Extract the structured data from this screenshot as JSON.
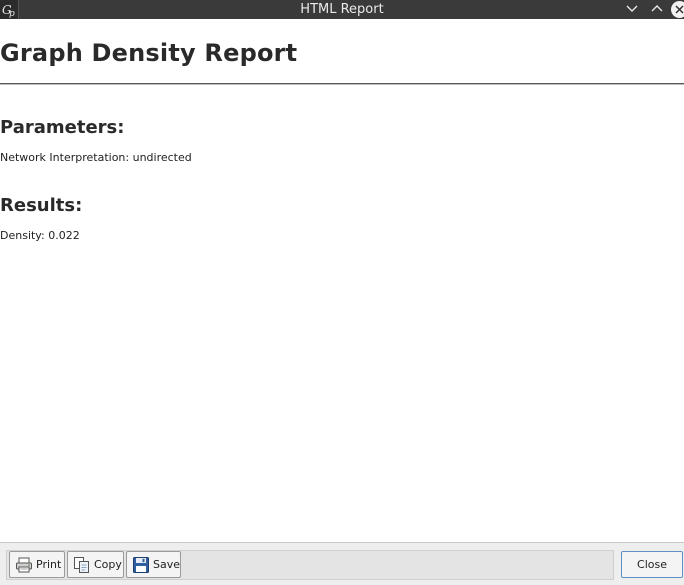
{
  "window": {
    "title": "HTML Report",
    "app_icon": "gephi-logo-icon",
    "controls": [
      "minimize-icon",
      "maximize-icon",
      "close-icon"
    ]
  },
  "report": {
    "title": "Graph Density Report",
    "parameters_heading": "Parameters:",
    "network_interpretation": "Network Interpretation: undirected",
    "results_heading": "Results:",
    "density": "Density: 0.022"
  },
  "toolbar": {
    "print_label": "Print",
    "copy_label": "Copy",
    "save_label": "Save",
    "close_label": "Close"
  }
}
